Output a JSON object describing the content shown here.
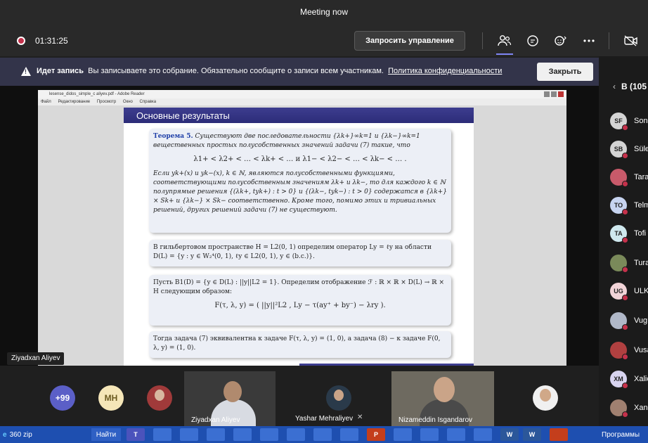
{
  "window": {
    "title": "Meeting now"
  },
  "controls": {
    "timer": "01:31:25",
    "request_control": "Запросить управление",
    "icons": [
      "participants-icon",
      "chat-icon",
      "reactions-icon",
      "more-icon",
      "camera-off-icon"
    ]
  },
  "banner": {
    "bold": "Идет запись",
    "text": "Вы записываете это собрание. Обязательно сообщите о записи всем участникам.",
    "link": "Политика конфиденциальности",
    "close": "Закрыть"
  },
  "side_panel": {
    "header": "В (105",
    "people": [
      {
        "initials": "SF",
        "name": "Sona",
        "color": "#d4d4d4"
      },
      {
        "initials": "SB",
        "name": "Süle",
        "color": "#d4d4d4"
      },
      {
        "initials": "",
        "name": "Tara",
        "color": "#c85a6a"
      },
      {
        "initials": "TO",
        "name": "Telm",
        "color": "#c7d4f0"
      },
      {
        "initials": "TA",
        "name": "Tofi",
        "color": "#cfe8ee"
      },
      {
        "initials": "",
        "name": "Tura",
        "color": "#7a8a5a"
      },
      {
        "initials": "UG",
        "name": "ULK",
        "color": "#f2d4d8"
      },
      {
        "initials": "",
        "name": "Vug",
        "color": "#b0b8c8"
      },
      {
        "initials": "",
        "name": "Vusa",
        "color": "#b04040"
      },
      {
        "initials": "XM",
        "name": "Xalic",
        "color": "#d8d4f0"
      },
      {
        "initials": "",
        "name": "Xan",
        "color": "#a08070"
      }
    ]
  },
  "reader": {
    "title": "lesense_didos_simple_c aliyev.pdf - Adobe Reader",
    "menu": [
      "Файл",
      "Редактирование",
      "Просмотр",
      "Окно",
      "Справка"
    ]
  },
  "slide": {
    "heading": "Основные результаты",
    "theorem_label": "Теорема 5.",
    "theorem_text": "Существуют две последовательности {λk+}∞k=1 и {λk−}∞k=1 вещественных простых полусобственных значений задачи (7) такие, что",
    "formula1": "λ1+ < λ2+ < … < λk+ < …   и   λ1− < λ2− < … < λk− < … .",
    "theorem_text2": "Если yk+(x) и yk−(x), k ∈ ℕ, являются полусобственными функциями, соответствующими полусобственным значениям λk+ и λk−, то для каждого k ∈ ℕ полупрямые решения {(λk+, tyk+) : t > 0} и {(λk−, tyk−) : t > 0} содержатся в {λk+} × Sk+ и {λk−} × Sk− соответственно. Кроме того, помимо этих и тривиальных решений, других решений задачи (7) не существуют.",
    "block2": "В гильбертовом пространстве H = L2(0, 1) определим оператор Ly = ℓy на области D(L) = {y : y ∈ W₂⁴(0, 1), ℓy ∈ L2(0, 1), y ∈ (b.c.)}.",
    "block3": "Пусть B1(D) = {y ∈ D(L) : ||y||L2 = 1}. Определим отображение ℱ : ℝ × ℝ × D(L) → ℝ × H следующим образом:",
    "formula2": "F(τ, λ, y) = ( ||y||²L2 , Ly − τ(ay⁺ + by⁻) − λry ).",
    "block4": "Тогда задача (7) эквивалентна к задаче F(τ, λ, y) = (1, 0), а задача (8) − к задаче F(0, λ, y) = (1, 0)."
  },
  "presenter_label": "Ziyadxan Aliyev",
  "strip": {
    "more_count": "+99",
    "mh_initials": "MH",
    "tiles": [
      {
        "name": "Ziyadxan Aliyev"
      },
      {
        "name": "Yashar Mehraliyev"
      },
      {
        "name": "Nizameddin Isgandarov"
      }
    ]
  },
  "taskbar": {
    "zip_label": "360 zip",
    "find_label": "Найти",
    "programs_label": "Программы",
    "apps": [
      "T",
      "",
      "",
      "",
      "",
      "",
      "",
      "",
      "",
      "P",
      "",
      "",
      "",
      "",
      "W",
      "W",
      ""
    ]
  }
}
